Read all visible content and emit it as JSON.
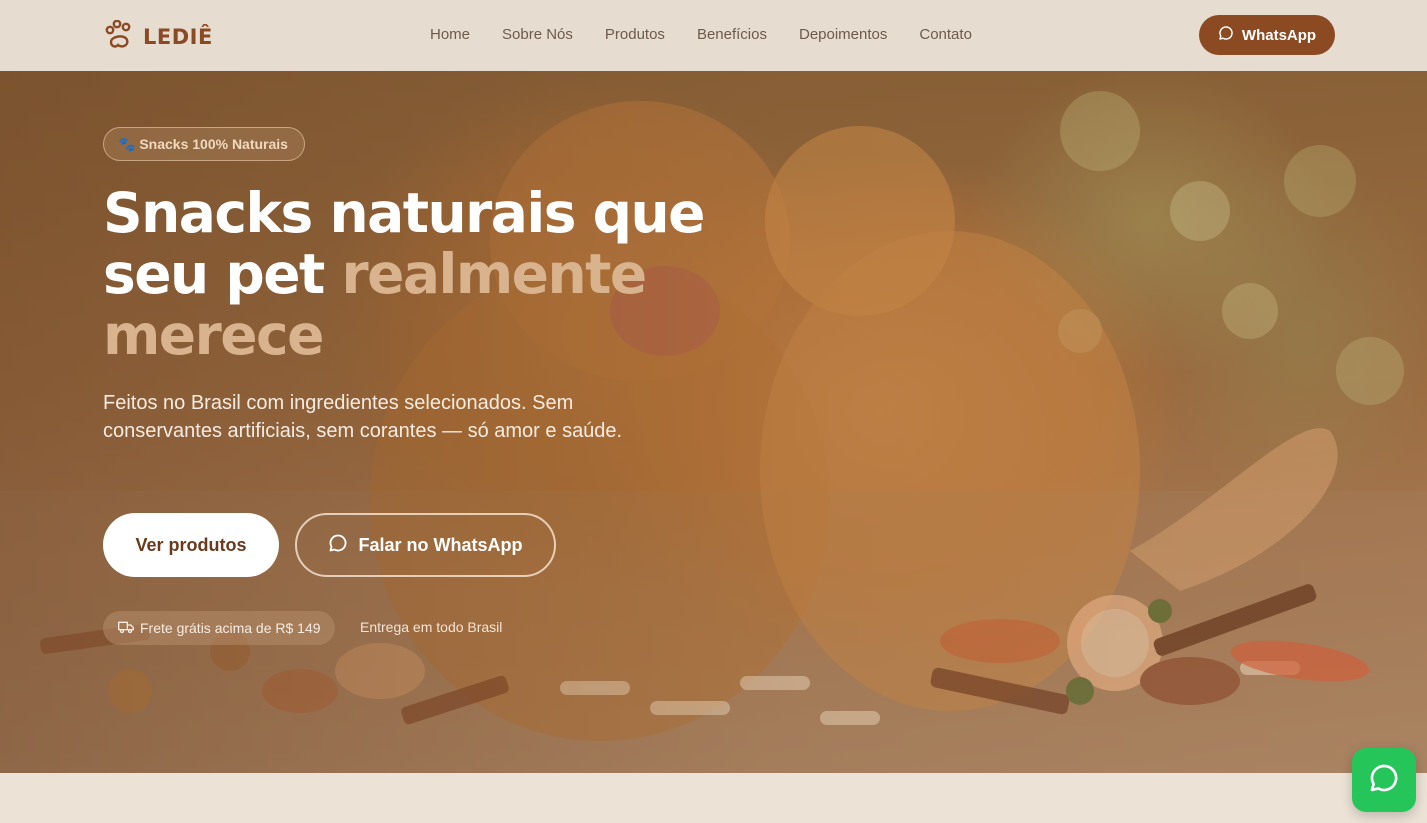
{
  "brand": {
    "name": "LEDIÊ",
    "icon": "paw-icon",
    "color": "#8a4a24"
  },
  "nav": {
    "links": [
      "Home",
      "Sobre Nós",
      "Produtos",
      "Benefícios",
      "Depoimentos",
      "Contato"
    ],
    "cta_label": "WhatsApp",
    "cta_color": "#8b4a22"
  },
  "hero": {
    "badge": "🐾 Snacks 100% Naturais",
    "headline_line1": "Snacks naturais que",
    "headline_line2_plain": "seu pet ",
    "headline_line2_accent": "realmente",
    "headline_line3_accent": "merece",
    "accent_color": "#d9b38e",
    "subtitle": "Feitos no Brasil com ingredientes selecionados. Sem conservantes artificiais, sem corantes — só amor e saúde.",
    "primary_button": "Ver produtos",
    "secondary_button": "Falar no WhatsApp",
    "shipping_pill": "Frete grátis acima de R$ 149",
    "delivery_text": "Entrega em todo Brasil"
  },
  "floating_whatsapp": {
    "icon": "whatsapp-icon",
    "color": "#25c55a"
  }
}
